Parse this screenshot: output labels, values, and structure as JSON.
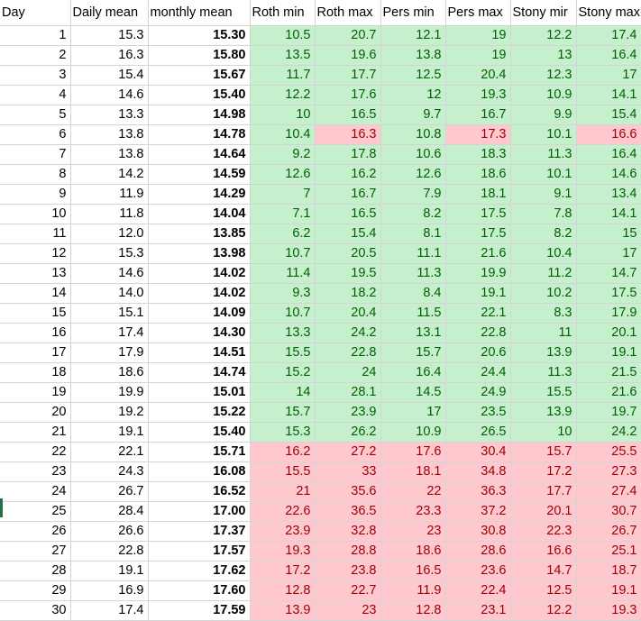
{
  "headers": [
    "Day",
    "Daily mean",
    "monthly mean",
    "Roth min",
    "Roth max",
    "Pers min",
    "Pers max",
    "Stony mir",
    "Stony max"
  ],
  "colors": {
    "good_bg": "#c6efce",
    "good_fg": "#006100",
    "bad_bg": "#ffc7ce",
    "bad_fg": "#9c0006"
  },
  "rows": [
    {
      "day": "1",
      "daily": "15.3",
      "monthly": "15.30",
      "rmin": "10.5",
      "rmax": "20.7",
      "pmin": "12.1",
      "pmax": "19",
      "smin": "12.2",
      "smax": "17.4",
      "hl": "gggggg"
    },
    {
      "day": "2",
      "daily": "16.3",
      "monthly": "15.80",
      "rmin": "13.5",
      "rmax": "19.6",
      "pmin": "13.8",
      "pmax": "19",
      "smin": "13",
      "smax": "16.4",
      "hl": "gggggg"
    },
    {
      "day": "3",
      "daily": "15.4",
      "monthly": "15.67",
      "rmin": "11.7",
      "rmax": "17.7",
      "pmin": "12.5",
      "pmax": "20.4",
      "smin": "12.3",
      "smax": "17",
      "hl": "gggggg"
    },
    {
      "day": "4",
      "daily": "14.6",
      "monthly": "15.40",
      "rmin": "12.2",
      "rmax": "17.6",
      "pmin": "12",
      "pmax": "19.3",
      "smin": "10.9",
      "smax": "14.1",
      "hl": "gggggg"
    },
    {
      "day": "5",
      "daily": "13.3",
      "monthly": "14.98",
      "rmin": "10",
      "rmax": "16.5",
      "pmin": "9.7",
      "pmax": "16.7",
      "smin": "9.9",
      "smax": "15.4",
      "hl": "gggggg"
    },
    {
      "day": "6",
      "daily": "13.8",
      "monthly": "14.78",
      "rmin": "10.4",
      "rmax": "16.3",
      "pmin": "10.8",
      "pmax": "17.3",
      "smin": "10.1",
      "smax": "16.6",
      "hl": "grgrgr"
    },
    {
      "day": "7",
      "daily": "13.8",
      "monthly": "14.64",
      "rmin": "9.2",
      "rmax": "17.8",
      "pmin": "10.6",
      "pmax": "18.3",
      "smin": "11.3",
      "smax": "16.4",
      "hl": "gggggg"
    },
    {
      "day": "8",
      "daily": "14.2",
      "monthly": "14.59",
      "rmin": "12.6",
      "rmax": "16.2",
      "pmin": "12.6",
      "pmax": "18.6",
      "smin": "10.1",
      "smax": "14.6",
      "hl": "gggggg"
    },
    {
      "day": "9",
      "daily": "11.9",
      "monthly": "14.29",
      "rmin": "7",
      "rmax": "16.7",
      "pmin": "7.9",
      "pmax": "18.1",
      "smin": "9.1",
      "smax": "13.4",
      "hl": "gggggg"
    },
    {
      "day": "10",
      "daily": "11.8",
      "monthly": "14.04",
      "rmin": "7.1",
      "rmax": "16.5",
      "pmin": "8.2",
      "pmax": "17.5",
      "smin": "7.8",
      "smax": "14.1",
      "hl": "gggggg"
    },
    {
      "day": "11",
      "daily": "12.0",
      "monthly": "13.85",
      "rmin": "6.2",
      "rmax": "15.4",
      "pmin": "8.1",
      "pmax": "17.5",
      "smin": "8.2",
      "smax": "15",
      "hl": "gggggg"
    },
    {
      "day": "12",
      "daily": "15.3",
      "monthly": "13.98",
      "rmin": "10.7",
      "rmax": "20.5",
      "pmin": "11.1",
      "pmax": "21.6",
      "smin": "10.4",
      "smax": "17",
      "hl": "gggggg"
    },
    {
      "day": "13",
      "daily": "14.6",
      "monthly": "14.02",
      "rmin": "11.4",
      "rmax": "19.5",
      "pmin": "11.3",
      "pmax": "19.9",
      "smin": "11.2",
      "smax": "14.7",
      "hl": "gggggg"
    },
    {
      "day": "14",
      "daily": "14.0",
      "monthly": "14.02",
      "rmin": "9.3",
      "rmax": "18.2",
      "pmin": "8.4",
      "pmax": "19.1",
      "smin": "10.2",
      "smax": "17.5",
      "hl": "gggggg"
    },
    {
      "day": "15",
      "daily": "15.1",
      "monthly": "14.09",
      "rmin": "10.7",
      "rmax": "20.4",
      "pmin": "11.5",
      "pmax": "22.1",
      "smin": "8.3",
      "smax": "17.9",
      "hl": "gggggg"
    },
    {
      "day": "16",
      "daily": "17.4",
      "monthly": "14.30",
      "rmin": "13.3",
      "rmax": "24.2",
      "pmin": "13.1",
      "pmax": "22.8",
      "smin": "11",
      "smax": "20.1",
      "hl": "gggggg"
    },
    {
      "day": "17",
      "daily": "17.9",
      "monthly": "14.51",
      "rmin": "15.5",
      "rmax": "22.8",
      "pmin": "15.7",
      "pmax": "20.6",
      "smin": "13.9",
      "smax": "19.1",
      "hl": "gggggg"
    },
    {
      "day": "18",
      "daily": "18.6",
      "monthly": "14.74",
      "rmin": "15.2",
      "rmax": "24",
      "pmin": "16.4",
      "pmax": "24.4",
      "smin": "11.3",
      "smax": "21.5",
      "hl": "gggggg"
    },
    {
      "day": "19",
      "daily": "19.9",
      "monthly": "15.01",
      "rmin": "14",
      "rmax": "28.1",
      "pmin": "14.5",
      "pmax": "24.9",
      "smin": "15.5",
      "smax": "21.6",
      "hl": "gggggg"
    },
    {
      "day": "20",
      "daily": "19.2",
      "monthly": "15.22",
      "rmin": "15.7",
      "rmax": "23.9",
      "pmin": "17",
      "pmax": "23.5",
      "smin": "13.9",
      "smax": "19.7",
      "hl": "gggggg"
    },
    {
      "day": "21",
      "daily": "19.1",
      "monthly": "15.40",
      "rmin": "15.3",
      "rmax": "26.2",
      "pmin": "10.9",
      "pmax": "26.5",
      "smin": "10",
      "smax": "24.2",
      "hl": "gggggg"
    },
    {
      "day": "22",
      "daily": "22.1",
      "monthly": "15.71",
      "rmin": "16.2",
      "rmax": "27.2",
      "pmin": "17.6",
      "pmax": "30.4",
      "smin": "15.7",
      "smax": "25.5",
      "hl": "rrrrrr"
    },
    {
      "day": "23",
      "daily": "24.3",
      "monthly": "16.08",
      "rmin": "15.5",
      "rmax": "33",
      "pmin": "18.1",
      "pmax": "34.8",
      "smin": "17.2",
      "smax": "27.3",
      "hl": "rrrrrr"
    },
    {
      "day": "24",
      "daily": "26.7",
      "monthly": "16.52",
      "rmin": "21",
      "rmax": "35.6",
      "pmin": "22",
      "pmax": "36.3",
      "smin": "17.7",
      "smax": "27.4",
      "hl": "rrrrrr"
    },
    {
      "day": "25",
      "daily": "28.4",
      "monthly": "17.00",
      "rmin": "22.6",
      "rmax": "36.5",
      "pmin": "23.3",
      "pmax": "37.2",
      "smin": "20.1",
      "smax": "30.7",
      "hl": "rrrrrr"
    },
    {
      "day": "26",
      "daily": "26.6",
      "monthly": "17.37",
      "rmin": "23.9",
      "rmax": "32.8",
      "pmin": "23",
      "pmax": "30.8",
      "smin": "22.3",
      "smax": "26.7",
      "hl": "rrrrrr"
    },
    {
      "day": "27",
      "daily": "22.8",
      "monthly": "17.57",
      "rmin": "19.3",
      "rmax": "28.8",
      "pmin": "18.6",
      "pmax": "28.6",
      "smin": "16.6",
      "smax": "25.1",
      "hl": "rrrrrr"
    },
    {
      "day": "28",
      "daily": "19.1",
      "monthly": "17.62",
      "rmin": "17.2",
      "rmax": "23.8",
      "pmin": "16.5",
      "pmax": "23.6",
      "smin": "14.7",
      "smax": "18.7",
      "hl": "rrrrrr"
    },
    {
      "day": "29",
      "daily": "16.9",
      "monthly": "17.60",
      "rmin": "12.8",
      "rmax": "22.7",
      "pmin": "11.9",
      "pmax": "22.4",
      "smin": "12.5",
      "smax": "19.1",
      "hl": "rrrrrr"
    },
    {
      "day": "30",
      "daily": "17.4",
      "monthly": "17.59",
      "rmin": "13.9",
      "rmax": "23",
      "pmin": "12.8",
      "pmax": "23.1",
      "smin": "12.2",
      "smax": "19.3",
      "hl": "rrrrrr"
    }
  ]
}
